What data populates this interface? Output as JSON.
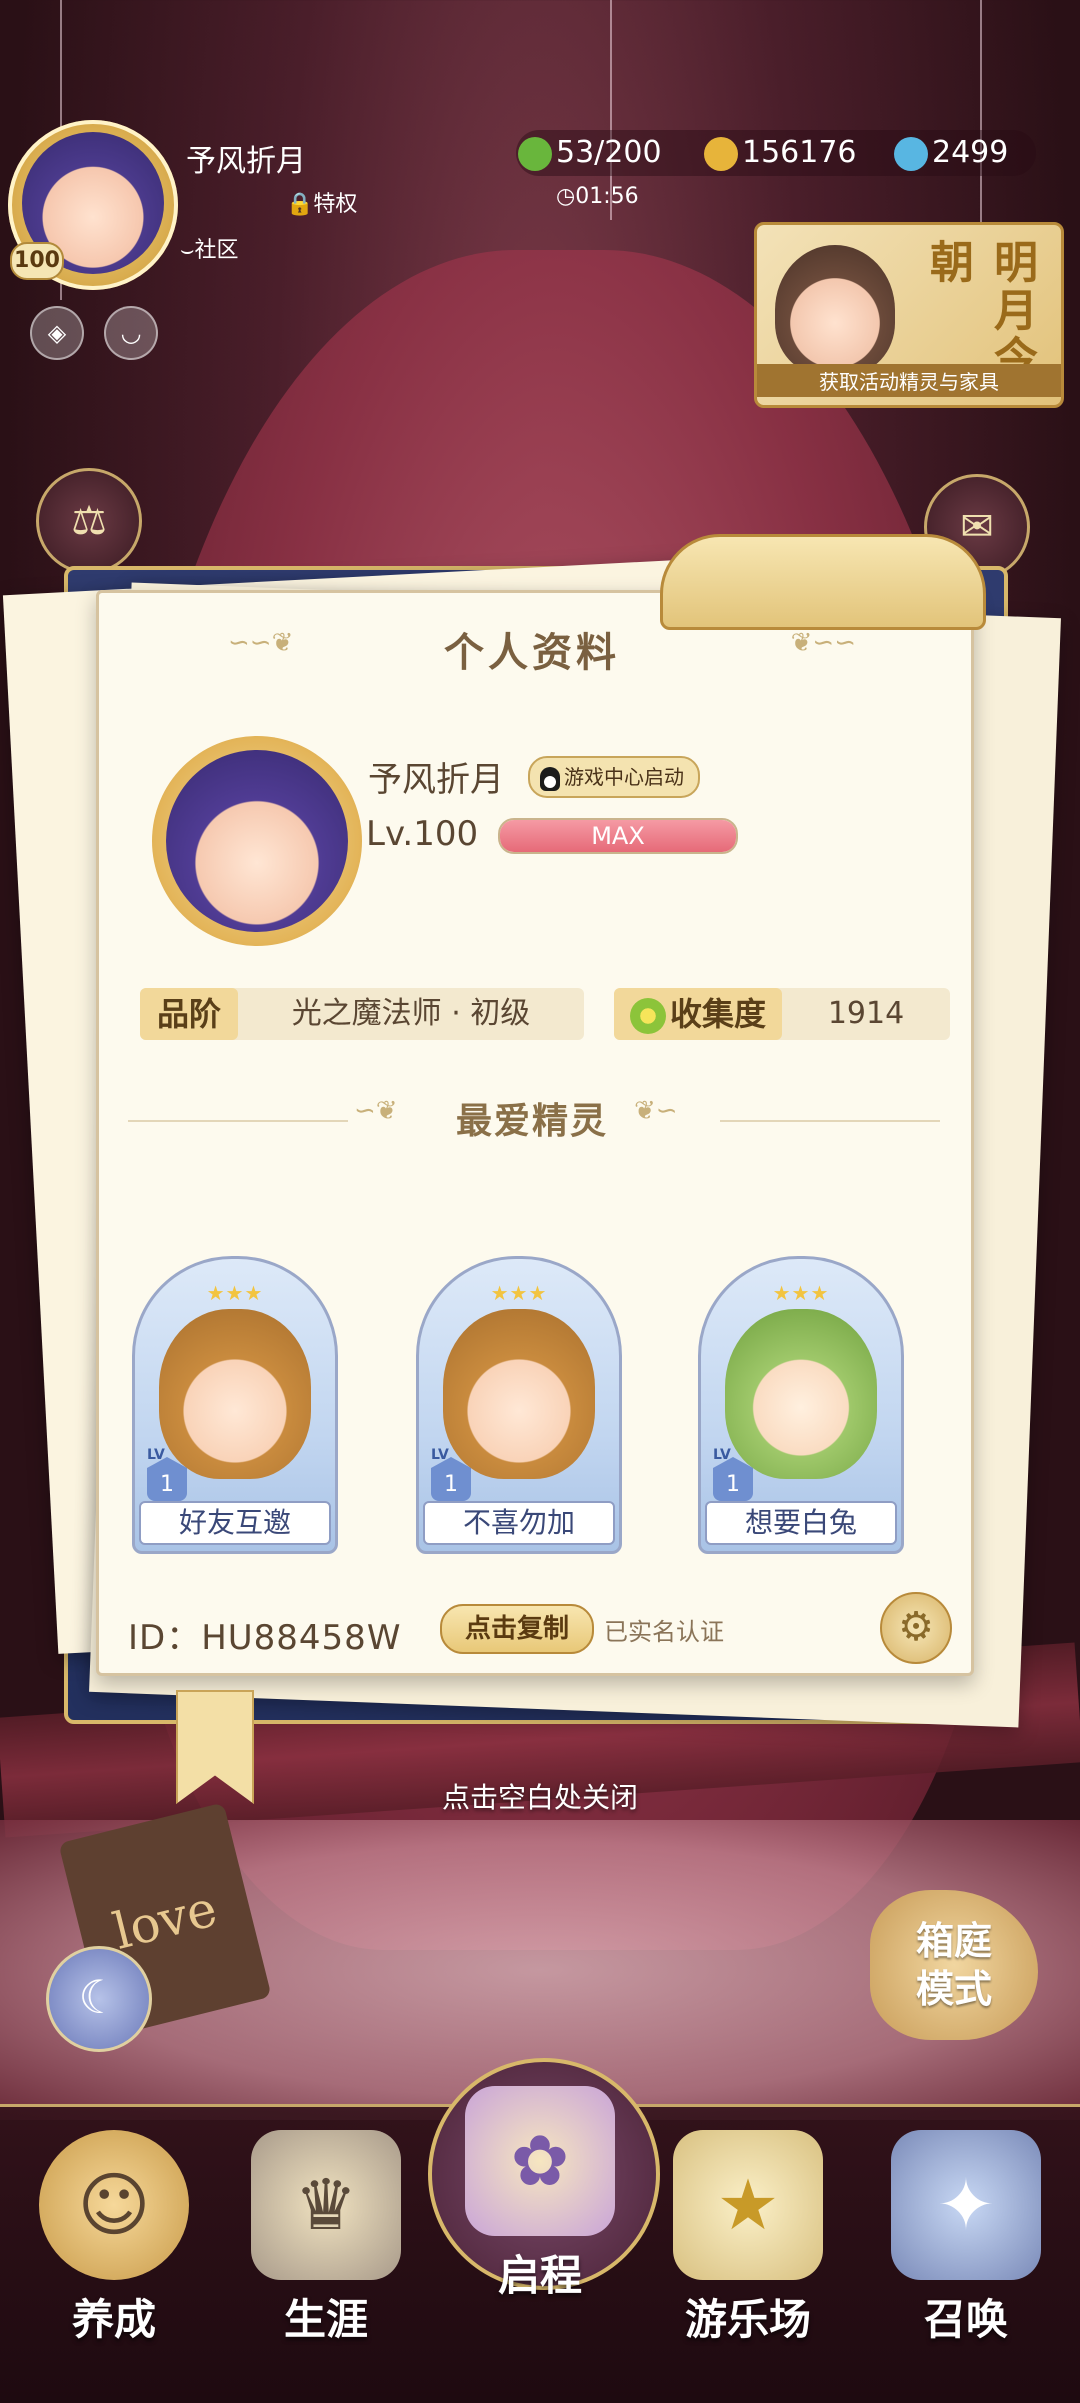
{
  "top_bar": {
    "player_name": "予风折月",
    "avatar_level": "100",
    "privilege_label": "特权",
    "community_label": "社区",
    "currencies": [
      {
        "name": "clover",
        "value": "53/200",
        "color": "#69b63c"
      },
      {
        "name": "coin",
        "value": "156176",
        "color": "#e7b43a"
      },
      {
        "name": "crystal",
        "value": "2499",
        "color": "#58b6e2"
      }
    ],
    "timer": "01:56"
  },
  "event_banner": {
    "title": "明月今朝",
    "subtitle": "获取活动精灵与家具"
  },
  "profile": {
    "title": "个人资料",
    "name": "予风折月",
    "qq_badge": "游戏中心启动",
    "level": "Lv.100",
    "exp_label": "MAX",
    "exp_fraction": 1.0,
    "rank_label": "品阶",
    "rank_value": "光之魔法师 · 初级",
    "collection_label": "收集度",
    "collection_value": "1914",
    "favorites_title": "最爱精灵",
    "favorites": [
      {
        "name": "好友互邀",
        "level": "1",
        "stars": "★★★",
        "hair": "#c98b3e"
      },
      {
        "name": "不喜勿加",
        "level": "1",
        "stars": "★★★",
        "hair": "#c98b3e"
      },
      {
        "name": "想要白兔",
        "level": "1",
        "stars": "★★★",
        "hair": "#9fc86a"
      }
    ],
    "id_text": "ID：HU88458W",
    "copy_button": "点击复制",
    "verified_text": "已实名认证"
  },
  "close_hint": "点击空白处关闭",
  "love_tag": "love",
  "mode_button": [
    "箱庭",
    "模式"
  ],
  "bottom_nav": [
    {
      "label": "养成",
      "icon": "girl-portrait-icon"
    },
    {
      "label": "生涯",
      "icon": "crown-icon"
    },
    {
      "label": "启程",
      "icon": "butterfly-book-icon"
    },
    {
      "label": "游乐场",
      "icon": "star-shield-icon"
    },
    {
      "label": "召唤",
      "icon": "summon-card-icon"
    }
  ]
}
